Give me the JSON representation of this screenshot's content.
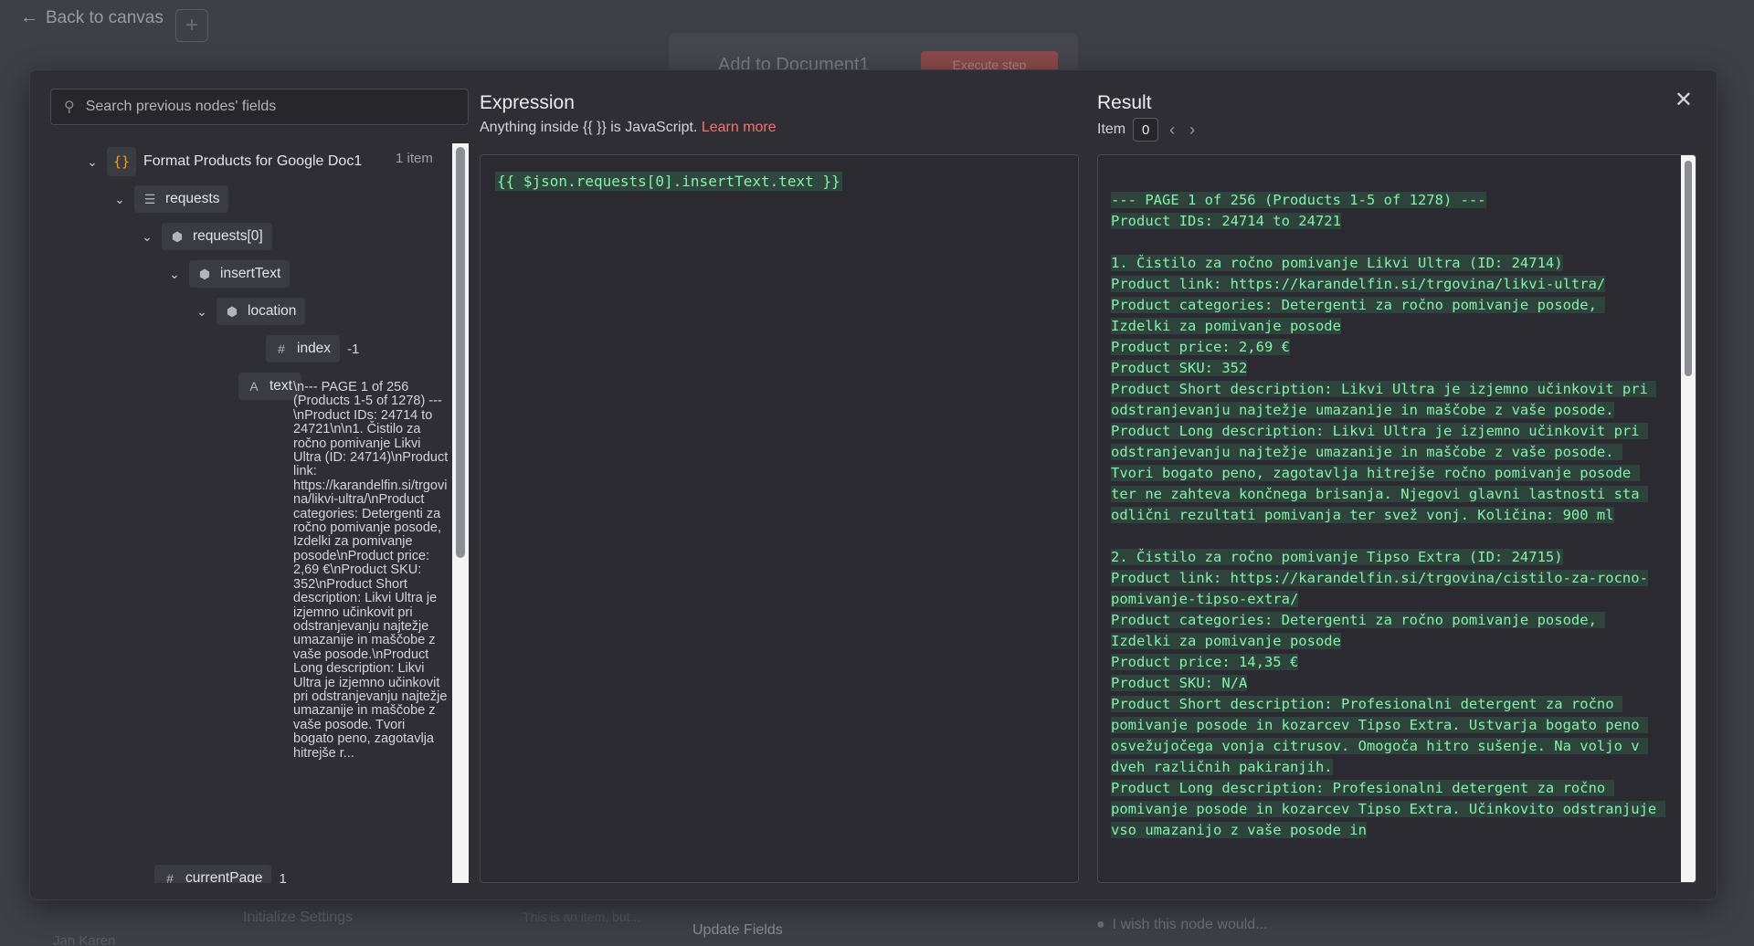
{
  "background": {
    "back_label": "Back to canvas",
    "node_title": "Add to Document1",
    "execute_label": "Execute step",
    "footer_left": "Initialize Settings",
    "footer_hint": "This is an item, but...",
    "footer_mid": "Update Fields",
    "footer_right": "I wish this node would...",
    "user_name": "Jan Karen"
  },
  "search": {
    "placeholder": "Search previous nodes' fields"
  },
  "tree": {
    "root": {
      "label": "Format Products for Google Doc1",
      "count": "1 item"
    },
    "nodes": {
      "requests": "requests",
      "requests0": "requests[0]",
      "insertText": "insertText",
      "location": "location",
      "index": "index",
      "index_value": "-1",
      "text": "text",
      "text_value": "\\n--- PAGE 1 of 256 (Products 1-5 of 1278) ---\\nProduct IDs: 24714 to 24721\\n\\n1. Čistilo za ročno pomivanje Likvi Ultra (ID: 24714)\\nProduct link: https://karandelfin.si/trgovina/likvi-ultra/\\nProduct categories: Detergenti za ročno pomivanje posode, Izdelki za pomivanje posode\\nProduct price: 2,69 €\\nProduct SKU: 352\\nProduct Short description: Likvi Ultra je izjemno učinkovit pri odstranjevanju najtežje umazanije in maščobe z vaše posode.\\nProduct Long description: Likvi Ultra je izjemno učinkovit pri odstranjevanju najtežje umazanije in maščobe z vaše posode. Tvori bogato peno, zagotavlja hitrejše r...",
      "currentPage": "currentPage",
      "currentPage_value": "1"
    }
  },
  "expression": {
    "title": "Expression",
    "subtitle": "Anything inside {{ }} is JavaScript.",
    "learn_more": "Learn more",
    "code": "{{ $json.requests[0].insertText.text }}"
  },
  "result": {
    "title": "Result",
    "item_label": "Item",
    "item_value": "0",
    "text": "--- PAGE 1 of 256 (Products 1-5 of 1278) ---\nProduct IDs: 24714 to 24721\n\n1. Čistilo za ročno pomivanje Likvi Ultra (ID: 24714)\nProduct link: https://karandelfin.si/trgovina/likvi-ultra/\nProduct categories: Detergenti za ročno pomivanje posode, Izdelki za pomivanje posode\nProduct price: 2,69 €\nProduct SKU: 352\nProduct Short description: Likvi Ultra je izjemno učinkovit pri odstranjevanju najtežje umazanije in maščobe z vaše posode.\nProduct Long description: Likvi Ultra je izjemno učinkovit pri odstranjevanju najtežje umazanije in maščobe z vaše posode. Tvori bogato peno, zagotavlja hitrejše ročno pomivanje posode ter ne zahteva končnega brisanja. Njegovi glavni lastnosti sta odlični rezultati pomivanja ter svež vonj. Količina: 900 ml\n\n2. Čistilo za ročno pomivanje Tipso Extra (ID: 24715)\nProduct link: https://karandelfin.si/trgovina/cistilo-za-rocno-pomivanje-tipso-extra/\nProduct categories: Detergenti za ročno pomivanje posode, Izdelki za pomivanje posode\nProduct price: 14,35 €\nProduct SKU: N/A\nProduct Short description: Profesionalni detergent za ročno pomivanje posode in kozarcev Tipso Extra. Ustvarja bogato peno osvežujočega vonja citrusov. Omogoča hitro sušenje. Na voljo v dveh različnih pakiranjih.\nProduct Long description: Profesionalni detergent za ročno pomivanje posode in kozarcev Tipso Extra. Učinkovito odstranjuje vso umazanijo z vaše posode in"
  }
}
